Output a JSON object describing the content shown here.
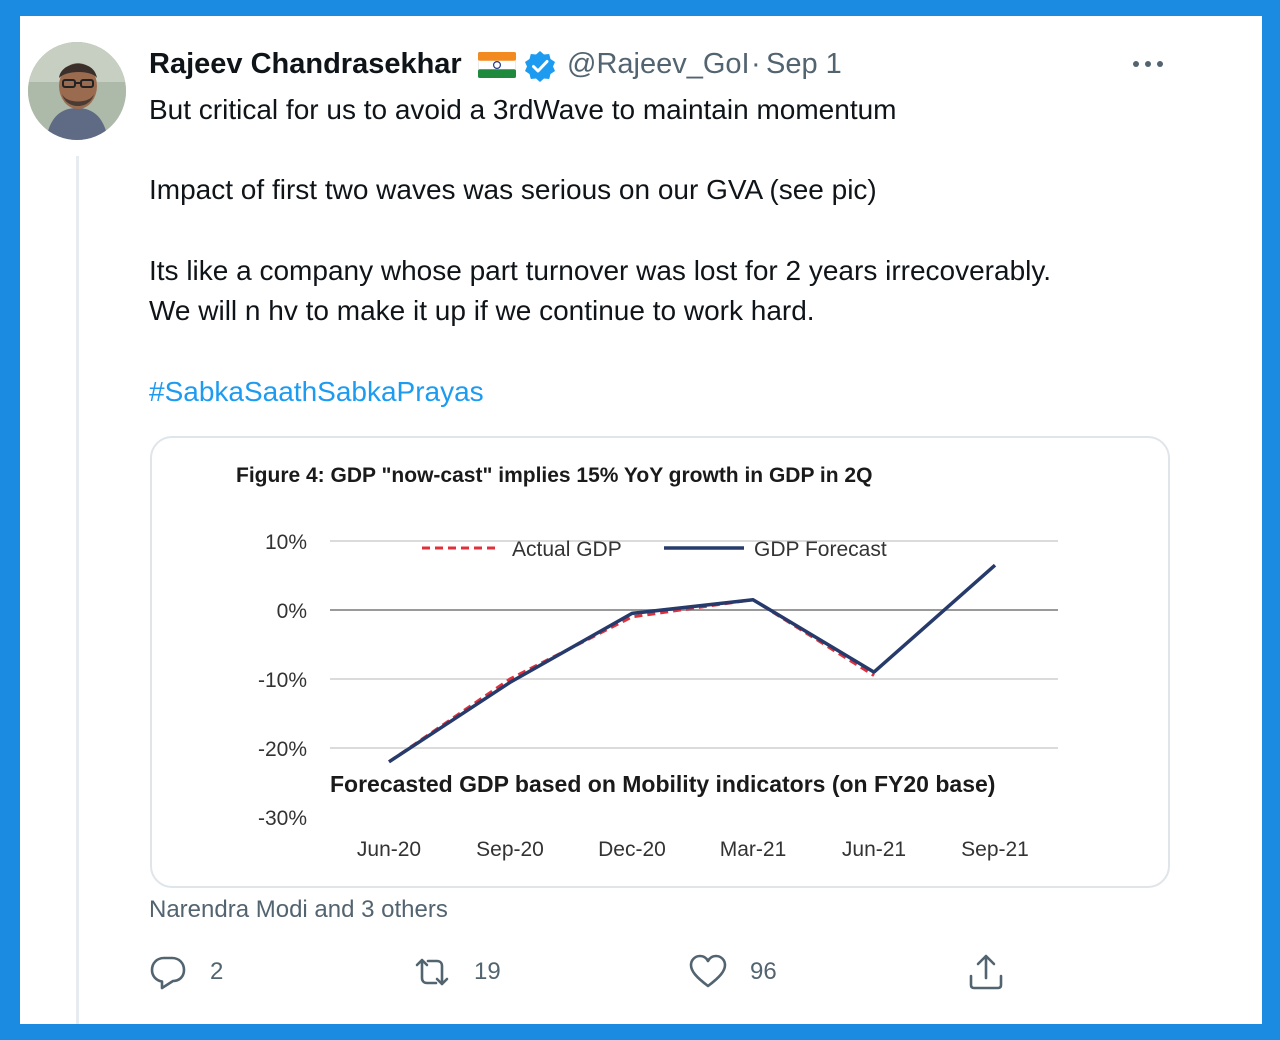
{
  "tweet": {
    "author_name": "Rajeev Chandrasekhar",
    "handle": "@Rajeev_GoI",
    "separator": "·",
    "date": "Sep 1",
    "text_lines": [
      "But critical for us to avoid a 3rdWave to maintain momentum",
      "Impact of first two waves was serious on our GVA (see pic)",
      "Its like a company whose part turnover was lost for 2 years irrecoverably.",
      "We will n hv to make it up if we continue to work hard."
    ],
    "hashtag": "#SabkaSaathSabkaPrayas",
    "liked_by": "Narendra Modi and 3 others",
    "hashtag_color": "#1d9bf0",
    "verified_color": "#1d9bf0",
    "icons": [
      "india-flag-icon",
      "verified-badge-icon",
      "more-options-icon",
      "reply-icon",
      "retweet-icon",
      "like-icon",
      "share-icon"
    ]
  },
  "actions": {
    "reply": {
      "icon": "reply-icon",
      "count": "2"
    },
    "retweet": {
      "icon": "retweet-icon",
      "count": "19"
    },
    "like": {
      "icon": "like-icon",
      "count": "96"
    },
    "share": {
      "icon": "share-icon"
    }
  },
  "chart_data": {
    "type": "line",
    "title": "Figure 4: GDP \"now-cast\" implies 15% YoY growth in GDP in 2Q",
    "annotation": "Forecasted  GDP based on Mobility indicators (on FY20 base)",
    "x": [
      "Jun-20",
      "Sep-20",
      "Dec-20",
      "Mar-21",
      "Jun-21",
      "Sep-21"
    ],
    "y_ticks": [
      "10%",
      "0%",
      "-10%",
      "-20%",
      "-30%"
    ],
    "ylim": [
      -30,
      10
    ],
    "grid": true,
    "legend_position": "top",
    "series": [
      {
        "name": "Actual GDP",
        "color": "#e0303b",
        "style": "dashed",
        "values": [
          -22,
          -10,
          -1,
          1.5,
          -9.5,
          null
        ]
      },
      {
        "name": "GDP Forecast",
        "color": "#263a6b",
        "style": "solid",
        "values": [
          -22,
          -10.5,
          -0.5,
          1.5,
          -9,
          6.5
        ]
      }
    ]
  }
}
